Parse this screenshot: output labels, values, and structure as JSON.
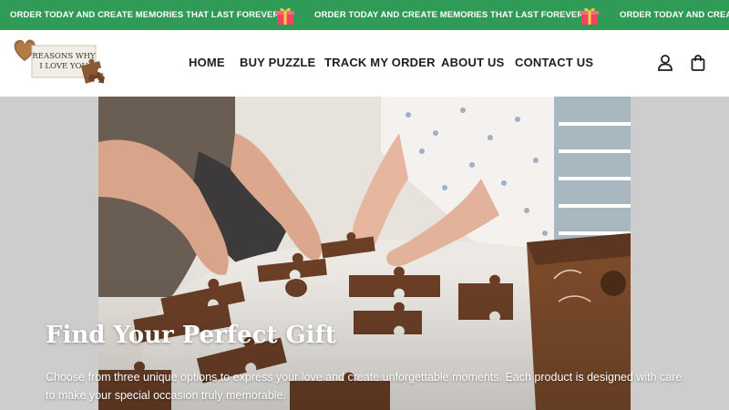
{
  "announcement": {
    "message": "ORDER TODAY AND CREATE MEMORIES THAT LAST FOREVER!",
    "icon": "gift-box-icon",
    "background": "#2f9b57"
  },
  "header": {
    "logo_line1": "REASONS WHY",
    "logo_line2": "I LOVE YOU",
    "nav": [
      {
        "label": "HOME"
      },
      {
        "label": "BUY PUZZLE"
      },
      {
        "label": "TRACK MY ORDER"
      },
      {
        "label": "ABOUT US"
      },
      {
        "label": "CONTACT US"
      }
    ],
    "icons": [
      "account-icon",
      "cart-icon"
    ]
  },
  "hero": {
    "title": "Find Your Perfect Gift",
    "description": "Choose from three unique options to express your love and create unforgettable moments. Each product is designed with care to make your special occasion truly memorable."
  }
}
